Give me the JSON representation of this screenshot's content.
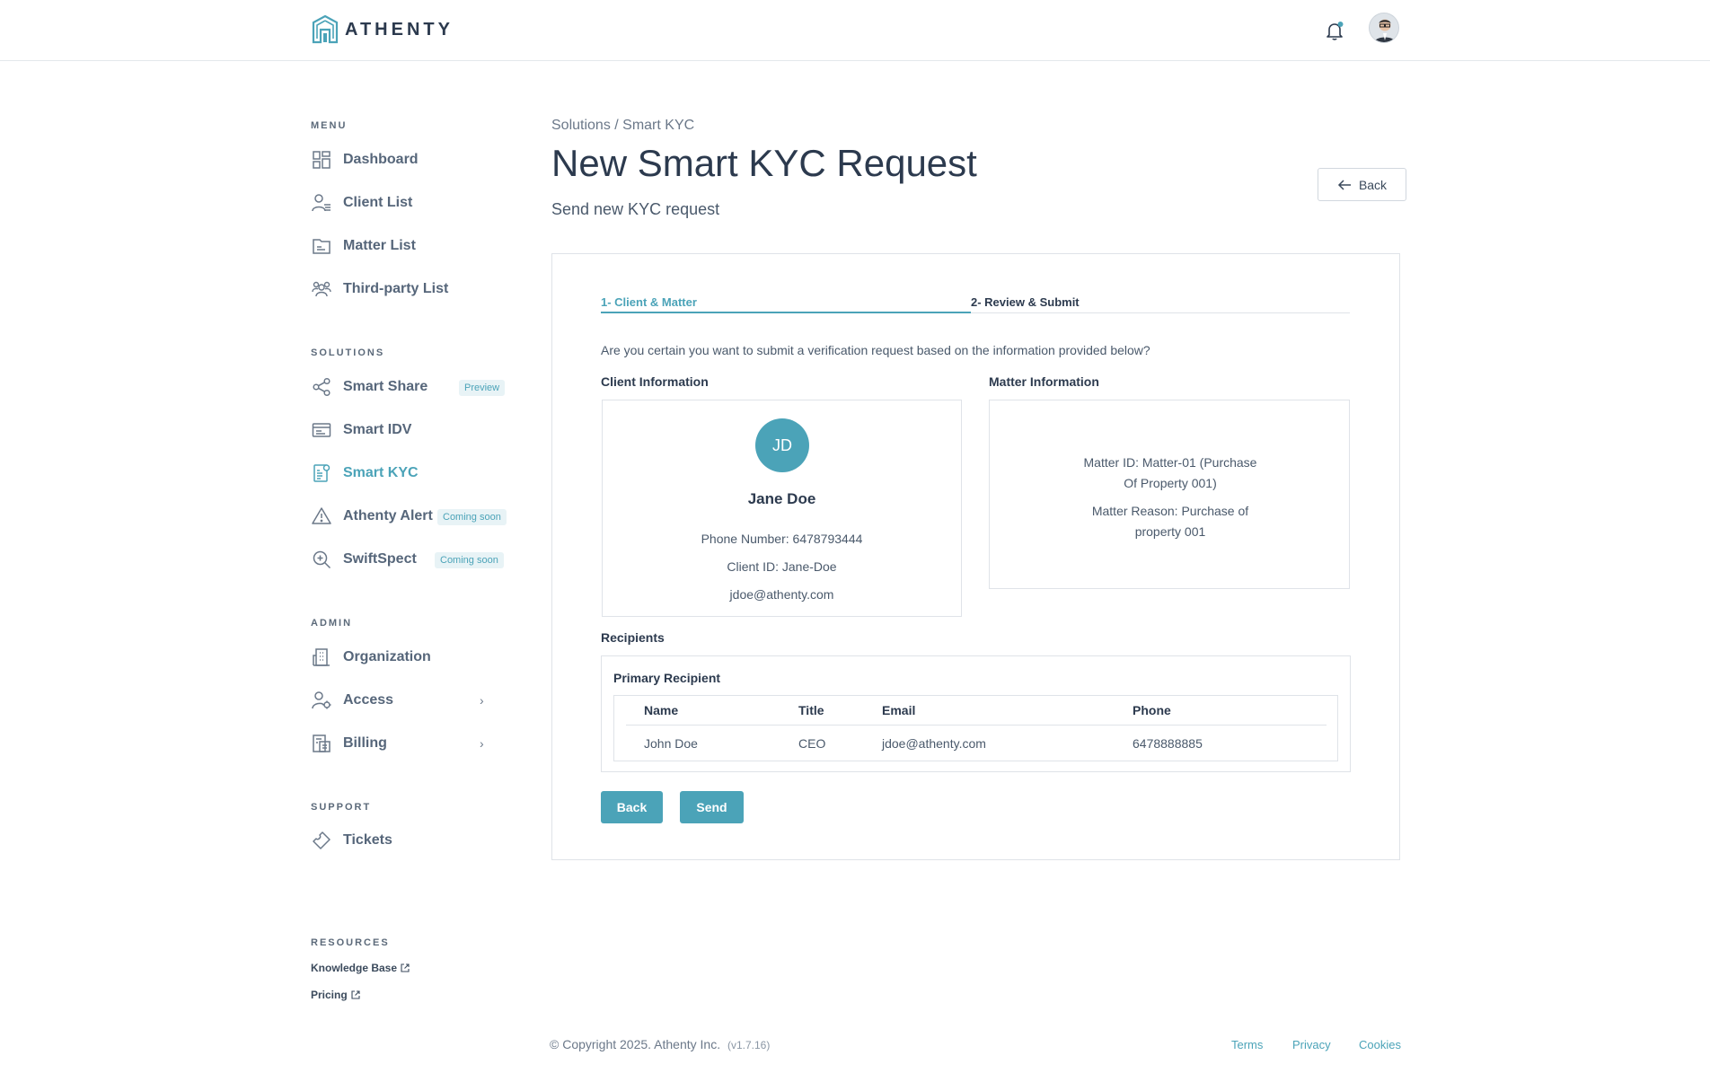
{
  "header": {
    "brand": "ATHENTY"
  },
  "sidebar": {
    "menu_title": "MENU",
    "menu_items": [
      {
        "label": "Dashboard"
      },
      {
        "label": "Client List"
      },
      {
        "label": "Matter List"
      },
      {
        "label": "Third-party List"
      }
    ],
    "solutions_title": "SOLUTIONS",
    "solutions_items": [
      {
        "label": "Smart Share",
        "badge": "Preview"
      },
      {
        "label": "Smart IDV"
      },
      {
        "label": "Smart KYC",
        "active": true
      },
      {
        "label": "Athenty Alert",
        "badge": "Coming soon"
      },
      {
        "label": "SwiftSpect",
        "badge": "Coming soon"
      }
    ],
    "admin_title": "ADMIN",
    "admin_items": [
      {
        "label": "Organization"
      },
      {
        "label": "Access"
      },
      {
        "label": "Billing"
      }
    ],
    "support_title": "SUPPORT",
    "support_items": [
      {
        "label": "Tickets"
      }
    ],
    "resources_title": "RESOURCES",
    "resources_links": [
      {
        "label": "Knowledge Base"
      },
      {
        "label": "Pricing"
      }
    ]
  },
  "main": {
    "breadcrumb": "Solutions / Smart KYC",
    "title": "New Smart KYC Request",
    "subtitle": "Send new KYC request",
    "back_label": "Back",
    "tabs": [
      {
        "label": "1- Client & Matter"
      },
      {
        "label": "2- Review & Submit"
      }
    ],
    "confirm_text": "Are you certain you want to submit a verification request based on the information provided below?",
    "client": {
      "section_title": "Client Information",
      "initials": "JD",
      "name": "Jane Doe",
      "phone": "Phone Number: 6478793444",
      "client_id": "Client ID: Jane-Doe",
      "email": "jdoe@athenty.com"
    },
    "matter": {
      "section_title": "Matter Information",
      "matter_id_line1": "Matter ID: Matter-01 (Purchase",
      "matter_id_line2": "Of Property 001)",
      "reason_line1": "Matter Reason: Purchase of",
      "reason_line2": "property 001"
    },
    "recipients": {
      "section_title": "Recipients",
      "primary_title": "Primary Recipient",
      "columns": [
        "Name",
        "Title",
        "Email",
        "Phone"
      ],
      "rows": [
        [
          "John Doe",
          "CEO",
          "jdoe@athenty.com",
          "6478888885"
        ]
      ]
    },
    "actions": {
      "back": "Back",
      "send": "Send"
    }
  },
  "footer": {
    "copyright": "© Copyright 2025. Athenty Inc.",
    "version": "(v1.7.16)",
    "links": [
      "Terms",
      "Privacy",
      "Cookies"
    ]
  },
  "colors": {
    "accent": "#4ba3b8",
    "text": "#3b4a5c",
    "border": "#dfe3e8"
  }
}
